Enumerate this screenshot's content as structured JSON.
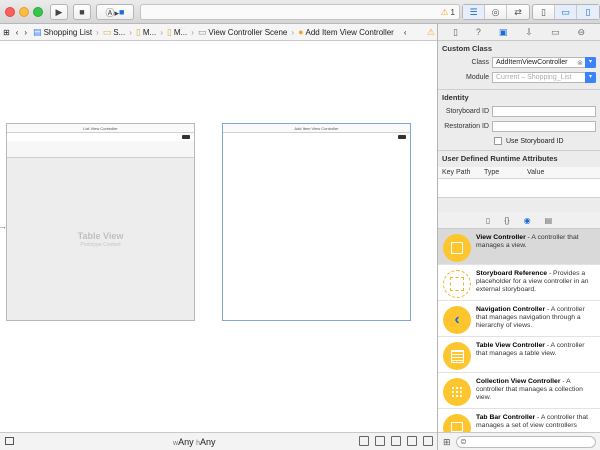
{
  "toolbar": {
    "warning_count": "1"
  },
  "jumpbar": {
    "items": [
      {
        "label": "Shopping List"
      },
      {
        "label": "S..."
      },
      {
        "label": "M..."
      },
      {
        "label": "M..."
      },
      {
        "label": "View Controller Scene"
      },
      {
        "label": "Add Item View Controller"
      }
    ]
  },
  "canvas": {
    "scenes": [
      {
        "title": "List View Controller",
        "table_title": "Table View",
        "table_subtitle": "Prototype Content"
      },
      {
        "title": "Add Item View Controller"
      }
    ]
  },
  "bottombar": {
    "size_w": "w",
    "size_w_val": "Any",
    "size_h": "h",
    "size_h_val": "Any"
  },
  "inspector": {
    "custom_class": {
      "title": "Custom Class",
      "class_label": "Class",
      "class_value": "AddItemViewController",
      "module_label": "Module",
      "module_placeholder": "Current – Shopping_List"
    },
    "identity": {
      "title": "Identity",
      "storyboard_id_label": "Storyboard ID",
      "restoration_id_label": "Restoration ID",
      "use_storyboard_id": "Use Storyboard ID"
    },
    "udra": {
      "title": "User Defined Runtime Attributes",
      "col_key": "Key Path",
      "col_type": "Type",
      "col_value": "Value"
    }
  },
  "library": {
    "items": [
      {
        "name": "View Controller",
        "desc": " - A controller that manages a view."
      },
      {
        "name": "Storyboard Reference",
        "desc": " - Provides a placeholder for a view controller in an external storyboard."
      },
      {
        "name": "Navigation Controller",
        "desc": " - A controller that manages navigation through a hierarchy of views."
      },
      {
        "name": "Table View Controller",
        "desc": " - A controller that manages a table view."
      },
      {
        "name": "Collection View Controller",
        "desc": " - A controller that manages a collection view."
      },
      {
        "name": "Tab Bar Controller",
        "desc": " - A controller that manages a set of view controllers"
      }
    ]
  }
}
